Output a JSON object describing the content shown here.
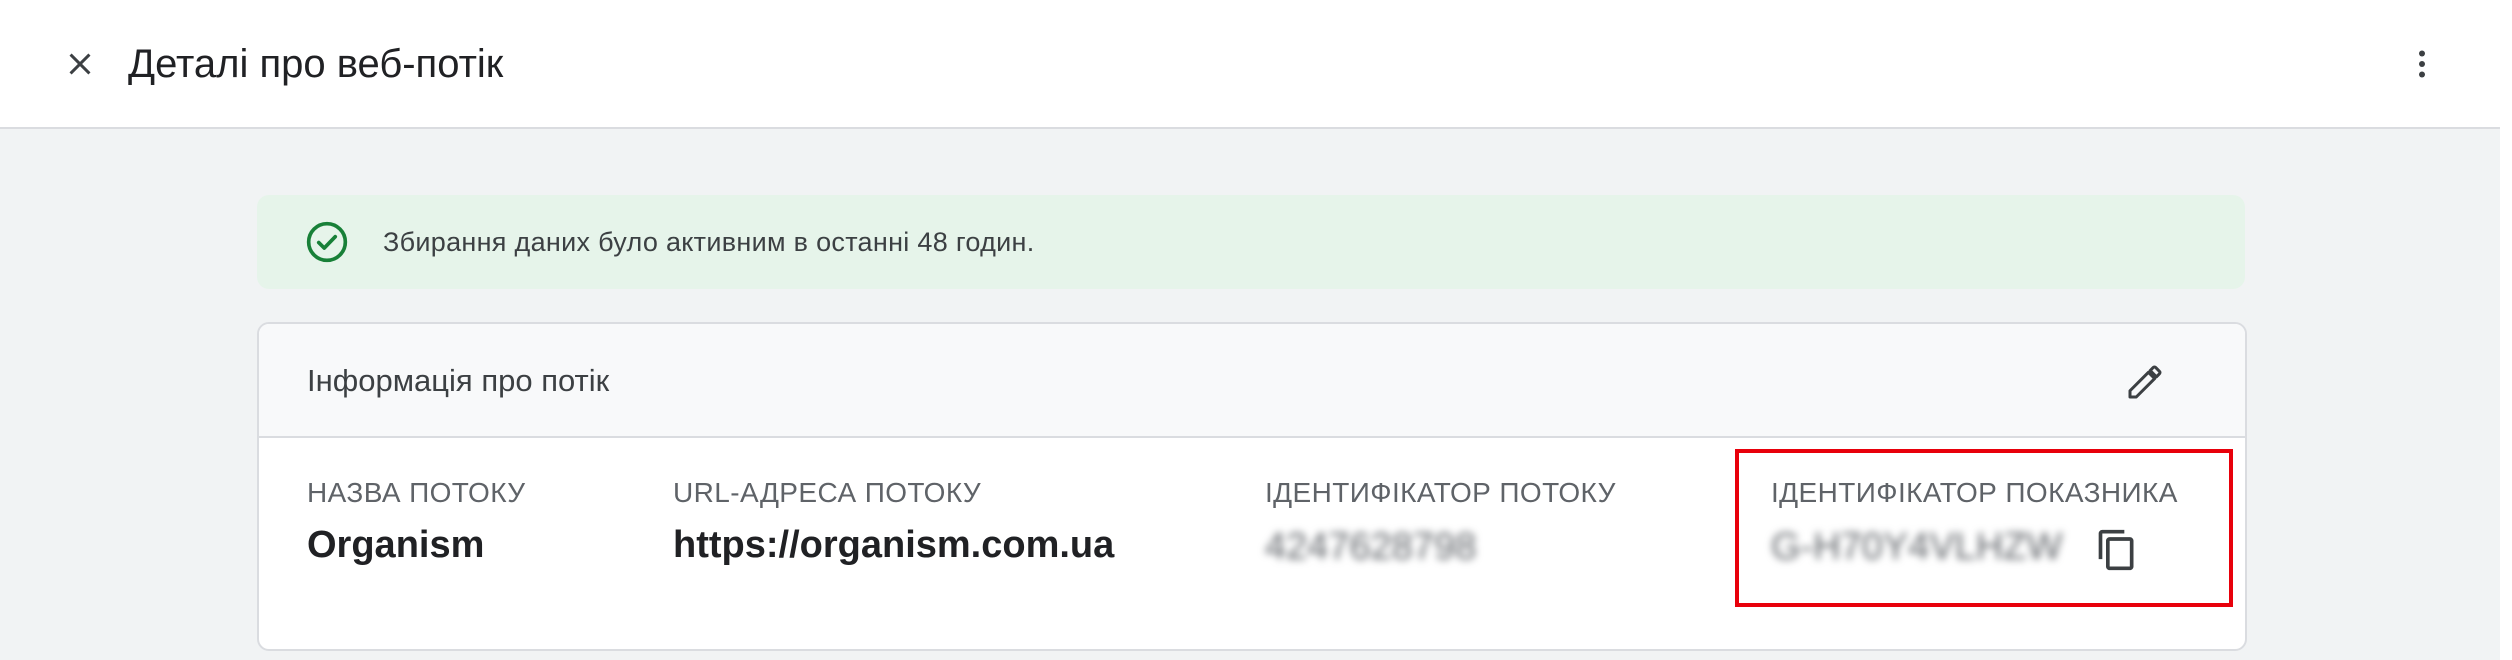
{
  "header": {
    "title": "Деталі про веб-потік",
    "close_icon": "close-icon",
    "more_icon": "more-vert-icon"
  },
  "banner": {
    "text": "Збирання даних було активним в останні 48 годин.",
    "icon": "check-circle-icon",
    "accent_color": "#188038"
  },
  "stream_card": {
    "title": "Інформація про потік",
    "edit_icon": "edit-icon",
    "fields": {
      "stream_name": {
        "label": "НАЗВА ПОТОКУ",
        "value": "Organism"
      },
      "stream_url": {
        "label": "URL-АДРЕСА ПОТОКУ",
        "value": "https://organism.com.ua"
      },
      "stream_id": {
        "label": "ІДЕНТИФІКАТОР ПОТОКУ",
        "value": "4247628798"
      },
      "measurement_id": {
        "label": "ІДЕНТИФІКАТОР ПОКАЗНИКА",
        "value": "G-H70Y4VLHZW",
        "copy_icon": "copy-icon"
      }
    }
  },
  "annotation": {
    "highlight_color": "#e8000b"
  }
}
